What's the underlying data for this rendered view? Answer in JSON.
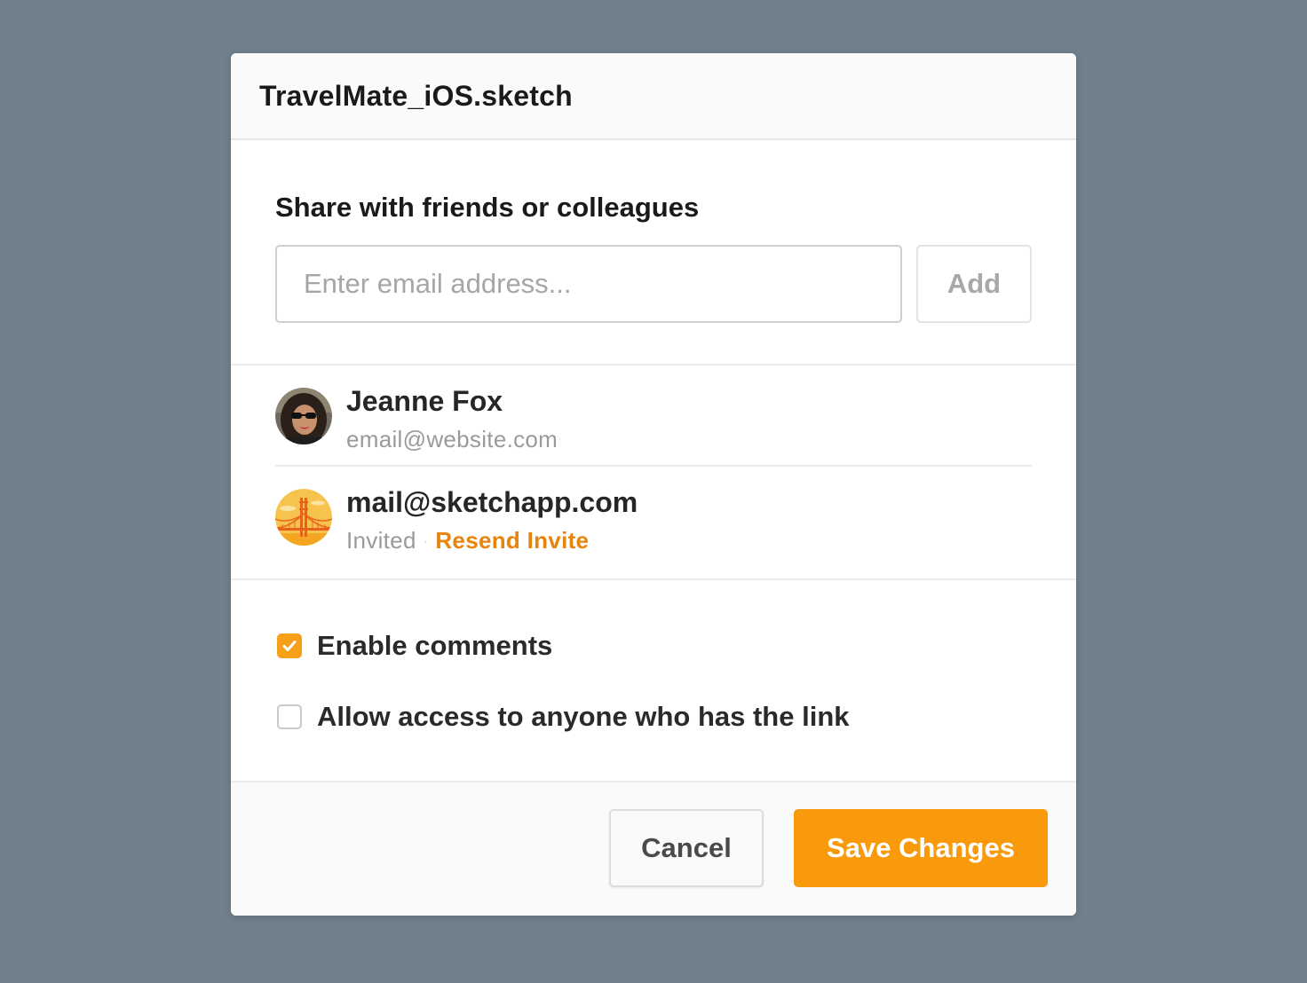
{
  "dialog": {
    "title": "TravelMate_iOS.sketch"
  },
  "share": {
    "heading": "Share with friends or colleagues",
    "email_placeholder": "Enter email address...",
    "email_value": "",
    "add_label": "Add"
  },
  "members": [
    {
      "name": "Jeanne Fox",
      "email": "email@website.com",
      "avatar": "profile-photo"
    },
    {
      "name": "mail@sketchapp.com",
      "status": "Invited",
      "separator": "·",
      "action": "Resend Invite",
      "avatar": "bridge-icon"
    }
  ],
  "options": [
    {
      "label": "Enable comments",
      "checked": true
    },
    {
      "label": "Allow access to anyone who has the link",
      "checked": false
    }
  ],
  "footer": {
    "cancel_label": "Cancel",
    "save_label": "Save Changes"
  },
  "colors": {
    "background": "#71808d",
    "accent": "#f89a0b",
    "link": "#e8830c"
  }
}
